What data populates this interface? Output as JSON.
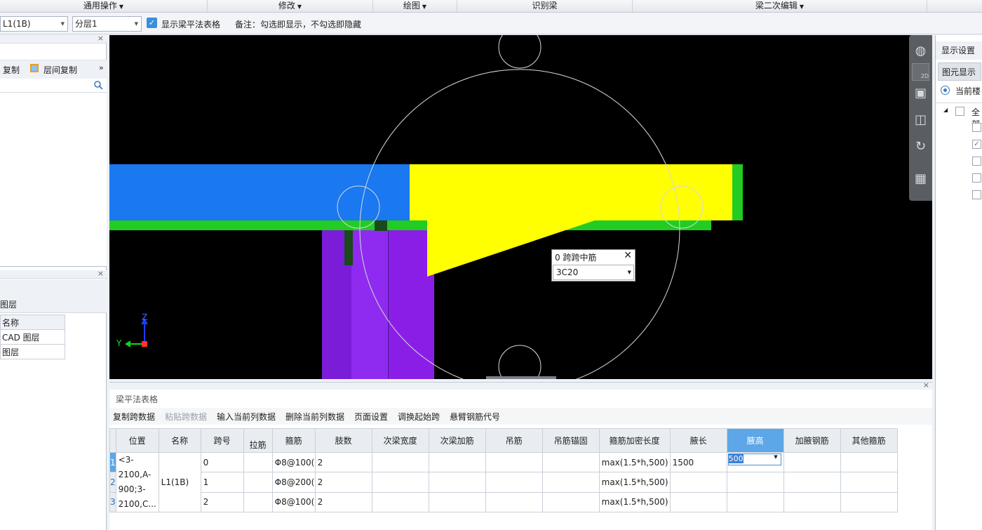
{
  "menubar": {
    "items": [
      {
        "label": "通用操作",
        "has_arrow": true
      },
      {
        "label": "修改",
        "has_arrow": true
      },
      {
        "label": "绘图",
        "has_arrow": true
      },
      {
        "label": "识别梁",
        "has_arrow": false
      },
      {
        "label": "梁二次编辑",
        "has_arrow": true
      }
    ]
  },
  "toolbar": {
    "component_select": "L1(1B)",
    "layer_select": "分层1",
    "show_table_checkbox_checked": true,
    "show_table_label": "显示梁平法表格",
    "note": "备注：勾选即显示，不勾选即隐藏"
  },
  "left_panel": {
    "copy_label": "复制",
    "floor_copy_label": "层间复制",
    "more_icon": "»",
    "layers_title": "图层",
    "layers_header": "名称",
    "layers": [
      "CAD 图层",
      "图层"
    ]
  },
  "viewport": {
    "popup_title": "0 跨跨中筋",
    "popup_value": "3C20",
    "axis_z": "Z",
    "axis_y": "Y",
    "view_tools": [
      "orbit-icon",
      "2d-view-icon",
      "cube-view-icon",
      "box-view-icon",
      "rotate-icon",
      "layer-toggle-icon"
    ],
    "view_2d_label": "2D"
  },
  "right_panel": {
    "display_settings": "显示设置",
    "element_display": "图元显示",
    "current_floor": "当前楼",
    "all_label": "全部",
    "checkboxes": [
      false,
      true,
      false,
      false,
      false
    ]
  },
  "beam_table": {
    "title": "梁平法表格",
    "actions": [
      {
        "label": "复制跨数据",
        "enabled": true
      },
      {
        "label": "粘贴跨数据",
        "enabled": false
      },
      {
        "label": "输入当前列数据",
        "enabled": true
      },
      {
        "label": "删除当前列数据",
        "enabled": true
      },
      {
        "label": "页面设置",
        "enabled": true
      },
      {
        "label": "调换起始跨",
        "enabled": true
      },
      {
        "label": "悬臂钢筋代号",
        "enabled": true
      }
    ],
    "columns": [
      "位置",
      "名称",
      "跨号",
      "拉筋",
      "箍筋",
      "肢数",
      "次梁宽度",
      "次梁加筋",
      "吊筋",
      "吊筋锚固",
      "箍筋加密长度",
      "腋长",
      "腋高",
      "加腋钢筋",
      "其他箍筋"
    ],
    "selected_column": "腋高",
    "position_text": "<3-2100,A-900;3-2100,C...",
    "name_text": "L1(1B)",
    "rows": [
      {
        "num": "1",
        "span": "0",
        "stirrup": "Φ8@100(",
        "legs": "2",
        "dense_len": "max(1.5*h,500)",
        "haunch_len": "1500",
        "haunch_h": "500"
      },
      {
        "num": "2",
        "span": "1",
        "stirrup": "Φ8@200(",
        "legs": "2",
        "dense_len": "max(1.5*h,500)",
        "haunch_len": "",
        "haunch_h": ""
      },
      {
        "num": "3",
        "span": "2",
        "stirrup": "Φ8@100(",
        "legs": "2",
        "dense_len": "max(1.5*h,500)",
        "haunch_len": "",
        "haunch_h": ""
      }
    ]
  },
  "colors": {
    "beam_blue": "#1a78f0",
    "beam_yellow": "#ffff00",
    "beam_green": "#22cc22",
    "column_purple": "#8a1ee6",
    "header_selected": "#5da7e8"
  }
}
